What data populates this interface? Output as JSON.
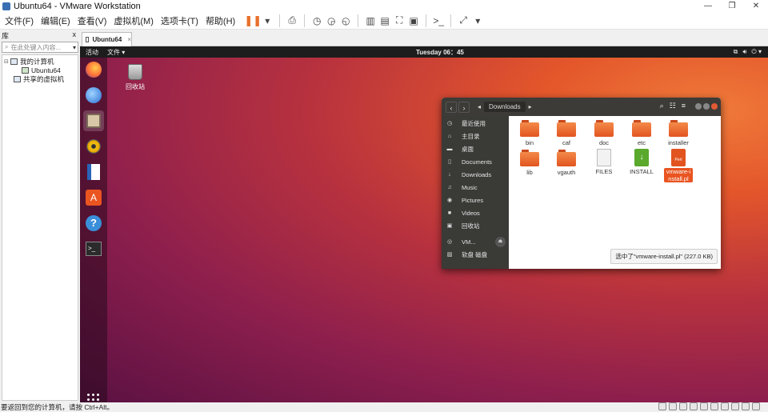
{
  "window": {
    "title": "Ubuntu64 - VMware Workstation"
  },
  "menu": [
    "文件(F)",
    "编辑(E)",
    "查看(V)",
    "虚拟机(M)",
    "选项卡(T)",
    "帮助(H)"
  ],
  "library": {
    "header": "库",
    "close": "x",
    "search_placeholder": "在此处键入内容...",
    "tree": {
      "root": "我的计算机",
      "vm": "Ubuntu64",
      "shared": "共享的虚拟机"
    }
  },
  "tab": {
    "label": "Ubuntu64",
    "close": "×"
  },
  "guest": {
    "activities": "活动",
    "files_menu": "文件 ▾",
    "clock": "Tuesday 06：45",
    "desktop_icon": "回收站"
  },
  "file_manager": {
    "location": "Downloads",
    "sidebar": [
      {
        "icon": "clock-icon",
        "label": "最近使用"
      },
      {
        "icon": "home-icon",
        "label": "主目录"
      },
      {
        "icon": "desktop-icon",
        "label": "桌面"
      },
      {
        "icon": "document-icon",
        "label": "Documents"
      },
      {
        "icon": "download-icon",
        "label": "Downloads"
      },
      {
        "icon": "music-icon",
        "label": "Music"
      },
      {
        "icon": "camera-icon",
        "label": "Pictures"
      },
      {
        "icon": "video-icon",
        "label": "Videos"
      },
      {
        "icon": "trash-icon",
        "label": "回收站"
      },
      {
        "icon": "disc-icon",
        "label": "VM..."
      },
      {
        "icon": "floppy-icon",
        "label": "软盘 磁盘"
      }
    ],
    "files": [
      {
        "name": "bin",
        "kind": "folder"
      },
      {
        "name": "caf",
        "kind": "folder"
      },
      {
        "name": "doc",
        "kind": "folder"
      },
      {
        "name": "etc",
        "kind": "folder"
      },
      {
        "name": "installer",
        "kind": "folder"
      },
      {
        "name": "lib",
        "kind": "folder"
      },
      {
        "name": "vgauth",
        "kind": "folder"
      },
      {
        "name": "FILES",
        "kind": "doc"
      },
      {
        "name": "INSTALL",
        "kind": "install"
      },
      {
        "name": "vmware-install.pl",
        "kind": "perl",
        "selected": true
      }
    ],
    "status": "选中了\"vmware-install.pl\" (227.0 KB)"
  },
  "statusbar": {
    "text": "要返回到您的计算机，请按 Ctrl+Alt。"
  },
  "colors": {
    "ubuntu_orange": "#e95420",
    "accent_pause": "#e8702a"
  }
}
